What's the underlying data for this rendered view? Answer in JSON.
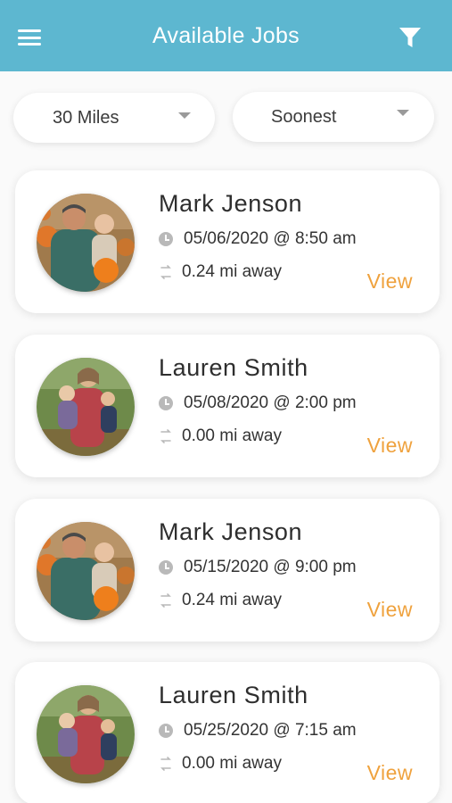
{
  "header": {
    "title": "Available Jobs",
    "menu_icon": "hamburger-menu-icon",
    "filter_icon": "funnel-filter-icon",
    "background_color": "#5db7d0"
  },
  "filters": {
    "distance": "30 Miles",
    "sort": "Soonest"
  },
  "jobs": [
    {
      "name": "Mark Jenson",
      "datetime": "05/06/2020 @ 8:50 am",
      "distance": "0.24 mi away",
      "action": "View",
      "avatar": "photo-man-with-child-pumpkins"
    },
    {
      "name": "Lauren Smith",
      "datetime": "05/08/2020 @ 2:00 pm",
      "distance": "0.00 mi away",
      "action": "View",
      "avatar": "photo-woman-with-child-field"
    },
    {
      "name": "Mark Jenson",
      "datetime": "05/15/2020 @ 9:00 pm",
      "distance": "0.24 mi away",
      "action": "View",
      "avatar": "photo-man-with-child-pumpkins"
    },
    {
      "name": "Lauren Smith",
      "datetime": "05/25/2020 @ 7:15 am",
      "distance": "0.00 mi away",
      "action": "View",
      "avatar": "photo-woman-with-child-field"
    }
  ],
  "colors": {
    "accent": "#efa23e",
    "icon_gray": "#b9b9b9"
  }
}
